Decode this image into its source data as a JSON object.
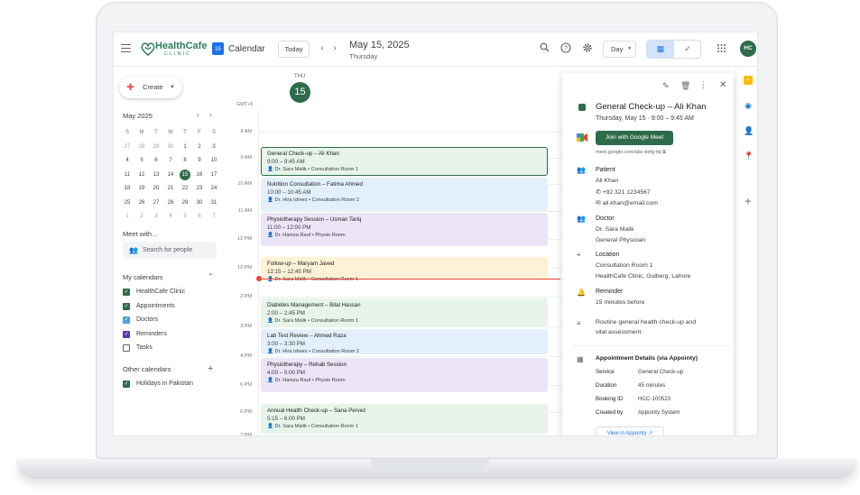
{
  "header": {
    "brand_name": "HealthCafe",
    "brand_sub": "CLINIC",
    "app_name": "Calendar",
    "app_icon_day": "15",
    "today_label": "Today",
    "date_title": "May 15, 2025",
    "day_name": "Thursday",
    "view_label": "Day",
    "avatar_initials": "HC",
    "icons": [
      "menu-icon",
      "search-icon",
      "help-icon",
      "gear-icon",
      "calendar-icon",
      "tasks-check-icon",
      "apps-grid-icon"
    ]
  },
  "sidebar": {
    "create_label": "Create",
    "mini_month": "May 2025",
    "weekdays": [
      "S",
      "M",
      "T",
      "W",
      "T",
      "F",
      "S"
    ],
    "weeks": [
      [
        "27",
        "28",
        "29",
        "30",
        "1",
        "2",
        "3"
      ],
      [
        "4",
        "5",
        "6",
        "7",
        "8",
        "9",
        "10"
      ],
      [
        "11",
        "12",
        "13",
        "14",
        "15",
        "16",
        "17"
      ],
      [
        "18",
        "19",
        "20",
        "21",
        "22",
        "23",
        "24"
      ],
      [
        "25",
        "26",
        "27",
        "28",
        "29",
        "30",
        "31"
      ],
      [
        "1",
        "2",
        "3",
        "4",
        "5",
        "6",
        "7"
      ]
    ],
    "selected_day": "15",
    "meet_with": "Meet with...",
    "search_placeholder": "Search for people",
    "my_calendars_title": "My calendars",
    "my_calendars": [
      {
        "label": "HealthCafe Clinic",
        "color": "#2e6b4a",
        "checked": true
      },
      {
        "label": "Appointments",
        "color": "#2e6b4a",
        "checked": true
      },
      {
        "label": "Doctors",
        "color": "#4ba3d9",
        "checked": true
      },
      {
        "label": "Reminders",
        "color": "#5e35b1",
        "checked": true
      },
      {
        "label": "Tasks",
        "color": "#1a73e8",
        "checked": false
      }
    ],
    "other_calendars_title": "Other calendars",
    "other_calendars": [
      {
        "label": "Holidays in Pakistan",
        "color": "#2e6b4a",
        "checked": true
      }
    ]
  },
  "grid": {
    "day_short": "THU",
    "day_num": "15",
    "timezone": "GMT+5",
    "hours": [
      "8 AM",
      "9 AM",
      "10 AM",
      "11 AM",
      "12 PM",
      "12 PM",
      "2 PM",
      "3 PM",
      "4 PM",
      "6 PM",
      "6 PM",
      "7 PM"
    ]
  },
  "events": [
    {
      "title": "General Check-up – Ali Khan",
      "time": "9:00 – 9:45 AM",
      "who": "Dr. Sara Malik • Consultation Room 1",
      "bg": "#e6f4ea",
      "border": "#2e6b4a"
    },
    {
      "title": "Nutrition Consultation – Fatima Ahmed",
      "time": "10:00 – 10:45 AM",
      "who": "Dr. Hira Idrees • Consultation Room 2",
      "bg": "#e3f0fb",
      "border": "#e3f0fb"
    },
    {
      "title": "Physiotherapy Session – Usman Tariq",
      "time": "11:00 – 12:00 PM",
      "who": "Dr. Hamza Rauf • Physio Room",
      "bg": "#ece4f7",
      "border": "#ece4f7"
    },
    {
      "title": "Follow-up – Maryam Javed",
      "time": "12:15 – 12:45 PM",
      "who": "Dr. Sara Malik • Consultation Room 1",
      "bg": "#fdf1d6",
      "border": "#fdf1d6"
    },
    {
      "title": "Diabetes Management – Bilal Hassan",
      "time": "2:00 – 2:45 PM",
      "who": "Dr. Sara Malik • Consultation Room 1",
      "bg": "#e6f4ea",
      "border": "#e6f4ea"
    },
    {
      "title": "Lab Test Review – Ahmed Raza",
      "time": "3:00 – 3:30 PM",
      "who": "Dr. Hira Idrees • Consultation Room 2",
      "bg": "#e3f0fb",
      "border": "#e3f0fb"
    },
    {
      "title": "Physiotherapy – Rehab Session",
      "time": "4:00 – 5:00 PM",
      "who": "Dr. Hamza Rauf • Physio Room",
      "bg": "#ece4f7",
      "border": "#ece4f7"
    },
    {
      "title": "Annual Health Check-up – Sana Pervez",
      "time": "5:15 – 6:00 PM",
      "who": "Dr. Sara Malik • Consultation Room 1",
      "bg": "#e6f4ea",
      "border": "#e6f4ea"
    }
  ],
  "details": {
    "title": "General Check-up – Ali Khan",
    "datetime": "Thursday, May 15  ·  9:00 – 9:45 AM",
    "join_label": "Join with Google Meet",
    "meet_url": "meet.google.com/abc-defg-hij",
    "patient_label": "Patient",
    "patient_name": "Ali Khan",
    "patient_phone": "+92 321 1234567",
    "patient_email": "ali.khan@email.com",
    "doctor_label": "Doctor",
    "doctor_name": "Dr. Sara Malik",
    "doctor_role": "General Physician",
    "location_label": "Location",
    "location_room": "Consultation Room 1",
    "location_addr": "HealthCafe Clinic, Gulberg, Lahore",
    "reminder_label": "Reminder",
    "reminder_value": "15 minutes before",
    "notes_line1": "Routine general health check-up and",
    "notes_line2": "vital assessment.",
    "appt_title": "Appointment Details (via Appointy)",
    "fields": [
      {
        "k": "Service",
        "v": "General Check-up"
      },
      {
        "k": "Duration",
        "v": "45 minutes"
      },
      {
        "k": "Booking ID",
        "v": "HCC-100523"
      },
      {
        "k": "Created by",
        "v": "Appointy System"
      }
    ],
    "view_label": "View in Appointy"
  }
}
